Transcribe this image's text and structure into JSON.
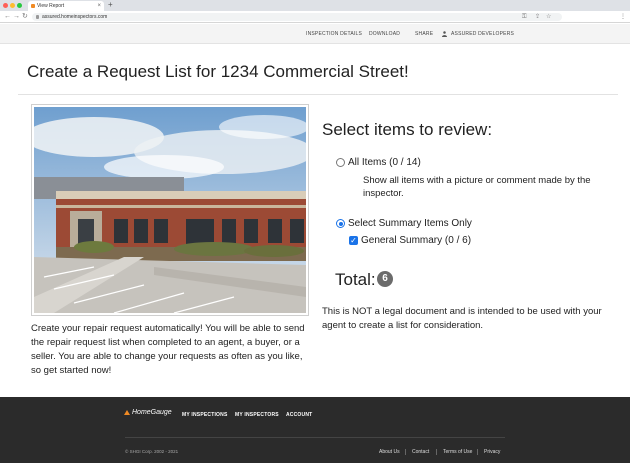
{
  "browser": {
    "tab_title": "View Report",
    "url": "assured.homeinspectors.com"
  },
  "site_nav": {
    "items": [
      "INSPECTION DETAILS",
      "DOWNLOAD",
      "SHARE",
      "ASSURED DEVELOPERS"
    ]
  },
  "page": {
    "title_prefix": "Create a Request List for",
    "title_address": "1234 Commercial Street!"
  },
  "left": {
    "description": "Create your repair request automatically! You will be able to send the repair request list when completed to an agent, a buyer, or a seller. You are able to change your requests as often as you like, so get started now!"
  },
  "right": {
    "heading": "Select items to review:",
    "all_items_label": "All Items (0 / 14)",
    "all_items_desc": "Show all items with a picture or comment made by the inspector.",
    "summary_label": "Select Summary Items Only",
    "general_summary_label": "General Summary (0 / 6)",
    "total_label": "Total:",
    "total_value": "6",
    "legal_notice": "This is NOT a legal document and is intended to be used with your agent to create a list for consideration."
  },
  "footer": {
    "logo": "HomeGauge",
    "nav": [
      "MY INSPECTIONS",
      "MY INSPECTORS",
      "ACCOUNT"
    ],
    "copyright": "© SHGI Corp. 2002 - 2021",
    "links": [
      "About Us",
      "Contact",
      "Terms of Use",
      "Privacy"
    ]
  },
  "colors": {
    "accent": "#1a73e8",
    "footer_bg": "#2b2b2b",
    "badge_bg": "#6b6b6b"
  }
}
